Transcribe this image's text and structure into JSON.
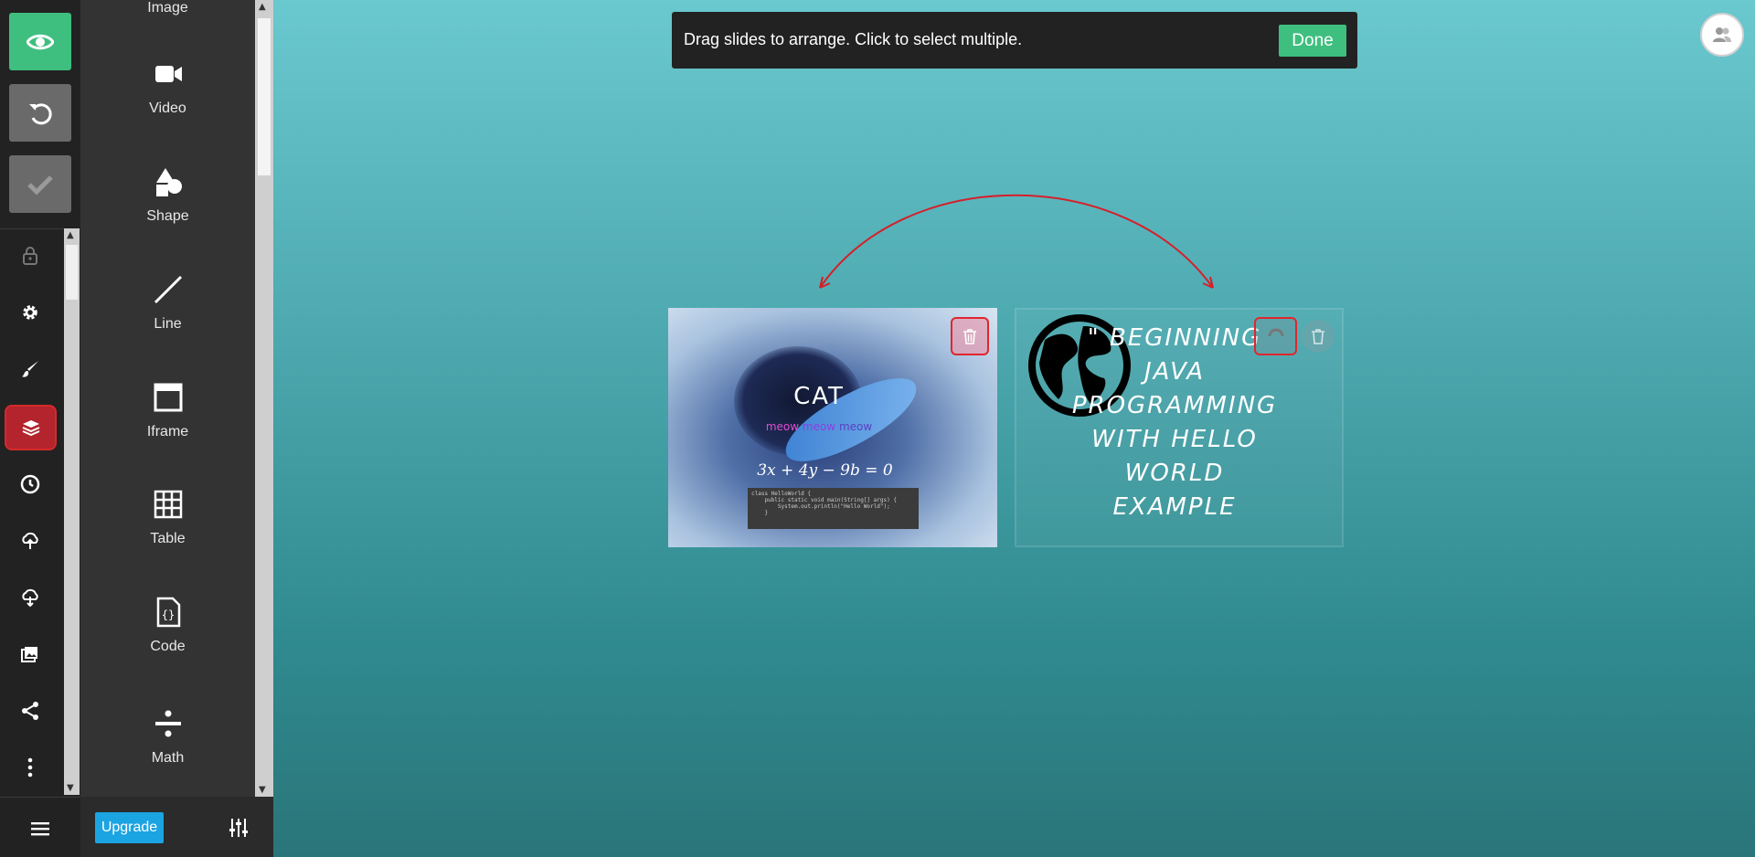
{
  "toolbar": {
    "top_buttons": [
      {
        "name": "preview",
        "icon": "eye-icon"
      },
      {
        "name": "undo",
        "icon": "undo-icon"
      },
      {
        "name": "save",
        "icon": "check-icon"
      }
    ],
    "items": [
      {
        "name": "lock",
        "icon": "lock-icon"
      },
      {
        "name": "settings",
        "icon": "gear-icon"
      },
      {
        "name": "style",
        "icon": "brush-icon"
      },
      {
        "name": "arrange",
        "icon": "layers-icon",
        "active": true
      },
      {
        "name": "history",
        "icon": "clock-icon"
      },
      {
        "name": "import",
        "icon": "cloud-upload-icon"
      },
      {
        "name": "export",
        "icon": "cloud-download-icon"
      },
      {
        "name": "media",
        "icon": "image-icon"
      },
      {
        "name": "share",
        "icon": "share-icon"
      },
      {
        "name": "more",
        "icon": "more-vertical-icon"
      }
    ],
    "menu_icon": "hamburger-icon"
  },
  "insert_panel": {
    "items": [
      {
        "label": "Image",
        "icon": "image-icon"
      },
      {
        "label": "Video",
        "icon": "video-icon"
      },
      {
        "label": "Shape",
        "icon": "shape-icon"
      },
      {
        "label": "Line",
        "icon": "line-icon"
      },
      {
        "label": "Iframe",
        "icon": "iframe-icon"
      },
      {
        "label": "Table",
        "icon": "table-icon"
      },
      {
        "label": "Code",
        "icon": "code-icon"
      },
      {
        "label": "Math",
        "icon": "math-icon"
      }
    ],
    "upgrade_label": "Upgrade",
    "settings_icon": "sliders-icon"
  },
  "notice": {
    "text": "Drag slides to arrange. Click to select multiple.",
    "done_label": "Done"
  },
  "collaborate_icon": "users-icon",
  "slides": [
    {
      "title": "CAT",
      "subtitle_words": [
        "meow",
        "meow",
        "meow"
      ],
      "math": "3x + 4y − 9b = 0",
      "code_lines": [
        "class HelloWorld {",
        "    public static void main(String[] args) {",
        "        System.out.println(\"Hello World\");",
        "    }"
      ]
    },
    {
      "title": "\" BEGINNING JAVA PROGRAMMING WITH HELLO WORLD EXAMPLE",
      "title_lines": [
        "\" BEGINNING",
        "JAVA",
        "PROGRAMMING",
        "WITH HELLO",
        "WORLD",
        "EXAMPLE"
      ]
    }
  ],
  "colors": {
    "accent_green": "#3fbf7f",
    "highlight_red": "#e0262e",
    "upgrade_blue": "#1ba4e2"
  }
}
